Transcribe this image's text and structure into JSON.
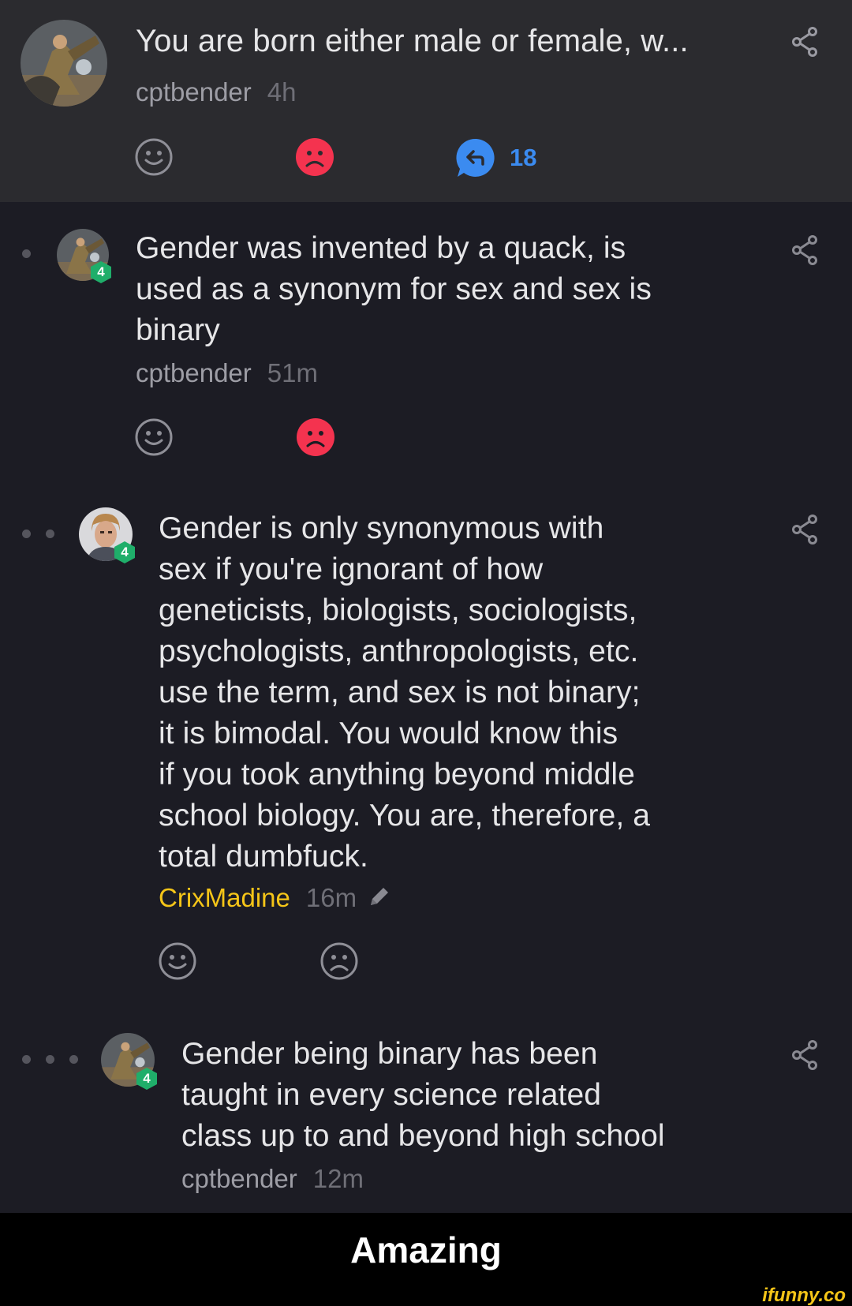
{
  "root": {
    "text": "You are born either male or female, w...",
    "author": "cptbender",
    "time": "4h",
    "reply_count": "18"
  },
  "comments": [
    {
      "depth": 1,
      "level_badge": "4",
      "lines": [
        "Gender was invented by a quack, is",
        "used as a synonym for sex and sex is",
        "binary"
      ],
      "author": "cptbender",
      "time": "51m"
    },
    {
      "depth": 2,
      "level_badge": "4",
      "lines": [
        "Gender is only synonymous with",
        "sex if you're ignorant of how",
        "geneticists, biologists, sociologists,",
        "psychologists, anthropologists, etc.",
        "use the term, and sex is not binary;",
        "it is bimodal. You would know this",
        "if you took anything beyond middle",
        "school biology. You are, therefore, a",
        "total dumbfuck."
      ],
      "author": "CrixMadine",
      "time": "16m",
      "edited": true
    },
    {
      "depth": 3,
      "level_badge": "4",
      "lines": [
        "Gender being binary has been",
        "taught in every science related",
        "class up to and beyond high school"
      ],
      "author": "cptbender",
      "time": "12m"
    }
  ],
  "icons": {
    "share": "share-icon",
    "smile": "smile-icon",
    "unsmile": "unsmile-icon",
    "reply": "reply-bubble-icon",
    "edit": "pencil-icon"
  },
  "colors": {
    "unsmile_active": "#f4334f",
    "reply_blue": "#3b8bf0",
    "badge_green": "#1fae6a",
    "author_highlight": "#f5c518"
  },
  "caption": "Amazing",
  "watermark": "ifunny.co"
}
